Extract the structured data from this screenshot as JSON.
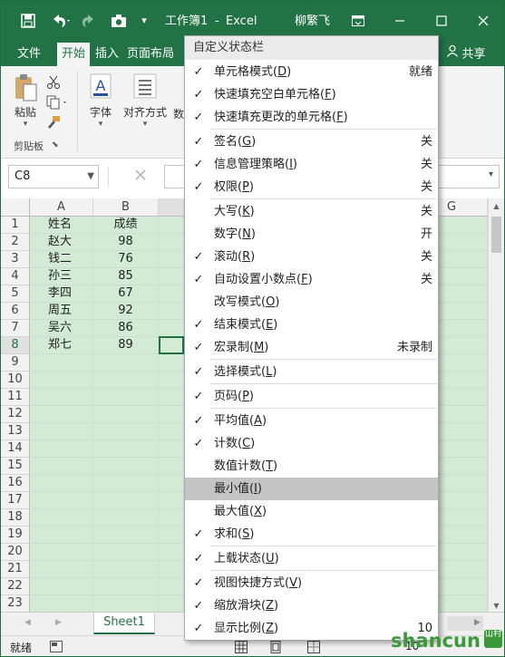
{
  "title_bar": {
    "save_icon": "save-icon",
    "undo_icon": "undo-icon",
    "redo_icon": "redo-icon",
    "camera_icon": "camera-icon",
    "customize_icon": "customize-qat-icon",
    "doc_title": "工作簿1",
    "separator": "-",
    "app_name": "Excel",
    "user_name": "柳繁飞",
    "ribbon_display_icon": "ribbon-display-icon",
    "minimize_icon": "minimize-icon",
    "restore_icon": "maximize-icon",
    "close_icon": "close-icon",
    "colors": {
      "brand": "#217346"
    }
  },
  "tabs": {
    "file": "文件",
    "home": "开始",
    "insert": "插入",
    "page_layout": "页面布局",
    "share": "共享"
  },
  "ribbon": {
    "paste_label": "粘贴",
    "font_label": "字体",
    "align_label": "对齐方式",
    "clipboard_group": "剪贴板",
    "partial_label": "数"
  },
  "formula_bar": {
    "name_box": "C8",
    "cancel_icon": "cancel-x-icon"
  },
  "sheet": {
    "columns": [
      "A",
      "B",
      "G"
    ],
    "rows": [
      "1",
      "2",
      "3",
      "4",
      "5",
      "6",
      "7",
      "8",
      "9",
      "10",
      "11",
      "12",
      "13",
      "14",
      "15",
      "16",
      "17",
      "18",
      "19",
      "20",
      "21",
      "22",
      "23"
    ],
    "data": [
      {
        "a": "姓名",
        "b": "成绩"
      },
      {
        "a": "赵大",
        "b": "98"
      },
      {
        "a": "钱二",
        "b": "76"
      },
      {
        "a": "孙三",
        "b": "85"
      },
      {
        "a": "李四",
        "b": "67"
      },
      {
        "a": "周五",
        "b": "92"
      },
      {
        "a": "吴六",
        "b": "86"
      },
      {
        "a": "郑七",
        "b": "89"
      }
    ],
    "tab_name": "Sheet1",
    "selected_cell": "C8"
  },
  "status_bar": {
    "ready": "就绪",
    "zoom_partial": "10"
  },
  "context_menu": {
    "title": "自定义状态栏",
    "items": [
      {
        "label": "单元格模式(",
        "key": "D",
        "tail": ")",
        "value": "就绪",
        "checked": true
      },
      {
        "label": "快速填充空白单元格(",
        "key": "F",
        "tail": ")",
        "value": "",
        "checked": true
      },
      {
        "label": "快速填充更改的单元格(",
        "key": "F",
        "tail": ")",
        "value": "",
        "checked": true
      },
      {
        "label": "签名(",
        "key": "G",
        "tail": ")",
        "value": "关",
        "checked": true
      },
      {
        "label": "信息管理策略(",
        "key": "I",
        "tail": ")",
        "value": "关",
        "checked": true
      },
      {
        "label": "权限(",
        "key": "P",
        "tail": ")",
        "value": "关",
        "checked": true
      },
      {
        "label": "大写(",
        "key": "K",
        "tail": ")",
        "value": "关",
        "checked": false
      },
      {
        "label": "数字(",
        "key": "N",
        "tail": ")",
        "value": "开",
        "checked": false
      },
      {
        "label": "滚动(",
        "key": "R",
        "tail": ")",
        "value": "关",
        "checked": true
      },
      {
        "label": "自动设置小数点(",
        "key": "F",
        "tail": ")",
        "value": "关",
        "checked": true
      },
      {
        "label": "改写模式(",
        "key": "O",
        "tail": ")",
        "value": "",
        "checked": false
      },
      {
        "label": "结束模式(",
        "key": "E",
        "tail": ")",
        "value": "",
        "checked": true
      },
      {
        "label": "宏录制(",
        "key": "M",
        "tail": ")",
        "value": "未录制",
        "checked": true
      },
      {
        "label": "选择模式(",
        "key": "L",
        "tail": ")",
        "value": "",
        "checked": true
      },
      {
        "label": "页码(",
        "key": "P",
        "tail": ")",
        "value": "",
        "checked": true
      },
      {
        "label": "平均值(",
        "key": "A",
        "tail": ")",
        "value": "",
        "checked": true
      },
      {
        "label": "计数(",
        "key": "C",
        "tail": ")",
        "value": "",
        "checked": true
      },
      {
        "label": "数值计数(",
        "key": "T",
        "tail": ")",
        "value": "",
        "checked": false
      },
      {
        "label": "最小值(",
        "key": "I",
        "tail": ")",
        "value": "",
        "checked": false,
        "highlighted": true
      },
      {
        "label": "最大值(",
        "key": "X",
        "tail": ")",
        "value": "",
        "checked": false
      },
      {
        "label": "求和(",
        "key": "S",
        "tail": ")",
        "value": "",
        "checked": true
      },
      {
        "label": "上载状态(",
        "key": "U",
        "tail": ")",
        "value": "",
        "checked": true
      },
      {
        "label": "视图快捷方式(",
        "key": "V",
        "tail": ")",
        "value": "",
        "checked": true
      },
      {
        "label": "缩放滑块(",
        "key": "Z",
        "tail": ")",
        "value": "",
        "checked": true
      },
      {
        "label": "显示比例(",
        "key": "Z",
        "tail": ")",
        "value": "10",
        "checked": true
      }
    ],
    "check_glyph": "✓"
  },
  "watermark": {
    "text": "shancun",
    "sub": "山村"
  }
}
